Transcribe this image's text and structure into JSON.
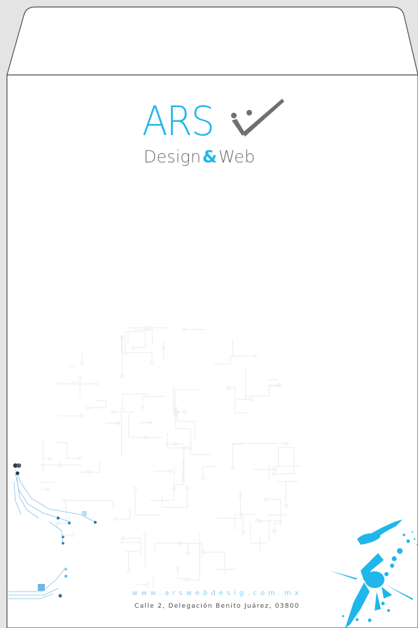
{
  "envelope": {
    "background": "#e4e4e4",
    "paper": "#ffffff",
    "outline": "#4d4d4d"
  },
  "logo": {
    "brand": "ARS",
    "line2_part1": "Design",
    "line2_amp": "&",
    "line2_part2": "Web",
    "brand_color": "#1fb6ea",
    "text_color": "#6d6e71",
    "mark_color": "#707070"
  },
  "footer": {
    "website": "www.arswebdesig.com.mx",
    "address": "Calle 2, Delegación Benito Juárez, 03800",
    "website_color": "#8ed0ee",
    "address_color": "#4a4a4a"
  },
  "decor": {
    "circuit_color": "#e9ecef",
    "accent_color": "#7cc3e5",
    "splash_color": "#1fb6ea",
    "icons": [
      "circuit-board-pattern",
      "circuit-trace-decoration",
      "paint-splash"
    ]
  }
}
